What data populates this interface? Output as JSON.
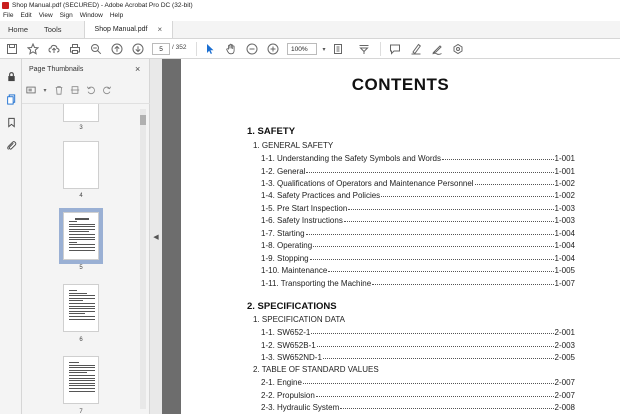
{
  "window": {
    "title": "Shop Manual.pdf (SECURED) - Adobe Acrobat Pro DC (32-bit)"
  },
  "menu": [
    "File",
    "Edit",
    "View",
    "Sign",
    "Window",
    "Help"
  ],
  "tabs": {
    "home": "Home",
    "tools": "Tools",
    "document": "Shop Manual.pdf",
    "document_close": "×"
  },
  "toolbar": {
    "page_current": "5",
    "page_total": "/ 352",
    "zoom": "100%",
    "icons": [
      "save-icon",
      "star-icon",
      "upload-icon",
      "print-icon",
      "zoom-out-search-icon",
      "prev-page-icon",
      "next-page-icon",
      "select-cursor-icon",
      "hand-icon",
      "zoom-out-icon",
      "zoom-in-icon",
      "zoom-dropdown-icon",
      "fit-page-icon",
      "scroll-mode-icon",
      "comment-icon",
      "highlight-icon",
      "sign-icon",
      "more-tools-icon"
    ]
  },
  "thumbnails_panel": {
    "title": "Page Thumbnails",
    "close": "×",
    "pages": [
      {
        "label": "3"
      },
      {
        "label": "4"
      },
      {
        "label": "5",
        "selected": true
      },
      {
        "label": "6"
      },
      {
        "label": "7"
      }
    ]
  },
  "document": {
    "heading": "CONTENTS",
    "sections": [
      {
        "title": "1. SAFETY",
        "groups": [
          {
            "title": "1. GENERAL SAFETY",
            "entries": [
              {
                "text": "1-1. Understanding the Safety Symbols and Words",
                "page": "1-001"
              },
              {
                "text": "1-2. General",
                "page": "1-001"
              },
              {
                "text": "1-3. Qualifications of Operators and Maintenance Personnel",
                "page": "1-002"
              },
              {
                "text": "1-4. Safety Practices and Policies",
                "page": "1-002"
              },
              {
                "text": "1-5. Pre Start Inspection",
                "page": "1-003"
              },
              {
                "text": "1-6. Safety Instructions",
                "page": "1-003"
              },
              {
                "text": "1-7. Starting",
                "page": "1-004"
              },
              {
                "text": "1-8. Operating",
                "page": "1-004"
              },
              {
                "text": "1-9. Stopping",
                "page": "1-004"
              },
              {
                "text": "1-10. Maintenance",
                "page": "1-005"
              },
              {
                "text": "1-11. Transporting the Machine",
                "page": "1-007"
              }
            ]
          }
        ]
      },
      {
        "title": "2. SPECIFICATIONS",
        "groups": [
          {
            "title": "1. SPECIFICATION DATA",
            "entries": [
              {
                "text": "1-1. SW652-1",
                "page": "2-001"
              },
              {
                "text": "1-2. SW652B-1",
                "page": "2-003"
              },
              {
                "text": "1-3. SW652ND-1",
                "page": "2-005"
              }
            ]
          },
          {
            "title": "2. TABLE OF STANDARD VALUES",
            "entries": [
              {
                "text": "2-1. Engine",
                "page": "2-007"
              },
              {
                "text": "2-2. Propulsion",
                "page": "2-007"
              },
              {
                "text": "2-3. Hydraulic System",
                "page": "2-008"
              }
            ]
          }
        ]
      }
    ]
  }
}
